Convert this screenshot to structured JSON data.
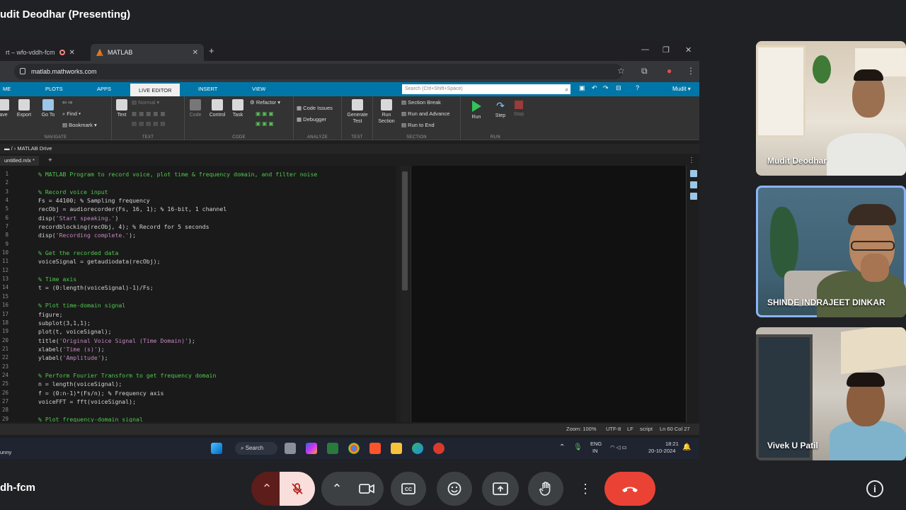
{
  "meet": {
    "presenter_title": "udit Deodhar (Presenting)",
    "meeting_code": "dh-fcm"
  },
  "browser": {
    "tabs": [
      {
        "label": "rt – wfo-vddh-fcm",
        "icon": "record-icon"
      },
      {
        "label": "MATLAB",
        "icon": "matlab-logo-icon"
      }
    ],
    "url": "matlab.mathworks.com"
  },
  "matlab": {
    "ribbon_tabs": [
      "ME",
      "PLOTS",
      "APPS",
      "LIVE EDITOR",
      "INSERT",
      "VIEW"
    ],
    "active_tab": "LIVE EDITOR",
    "search_placeholder": "Search (Ctrl+Shift+Space)",
    "user": "Mudit ▾",
    "sections": {
      "navigate": "NAVIGATE",
      "text": "TEXT",
      "code": "CODE",
      "analyze": "ANALYZE",
      "test": "TEST",
      "section": "SECTION",
      "run": "RUN"
    },
    "buttons": {
      "save": "ave",
      "export": "Export",
      "goto": "Go To",
      "find": "Find",
      "bookmark": "Bookmark",
      "text": "Text",
      "normal": "Normal",
      "code": "Code",
      "control": "Control",
      "task": "Task",
      "refactor": "Refactor",
      "code_issues": "Code Issues",
      "debugger": "Debugger",
      "generate_test_1": "Generate",
      "generate_test_2": "Test",
      "run_section_1": "Run",
      "run_section_2": "Section",
      "section_break": "Section Break",
      "run_and_advance": "Run and Advance",
      "run_to_end": "Run to End",
      "run": "Run",
      "step": "Step",
      "stop": "Stop"
    },
    "path": "MATLAB Drive",
    "file_tab": "untitled.mlx *",
    "code_lines": [
      {
        "n": "1",
        "t": "% MATLAB Program to record voice, plot time & frequency domain, and filter noise",
        "c": true
      },
      {
        "n": "2",
        "t": "",
        "c": false
      },
      {
        "n": "3",
        "t": "% Record voice input",
        "c": true
      },
      {
        "n": "4",
        "t": "Fs = 44100; % Sampling frequency",
        "c": false
      },
      {
        "n": "5",
        "t": "recObj = audiorecorder(Fs, 16, 1); % 16-bit, 1 channel",
        "c": false
      },
      {
        "n": "6",
        "t": "disp('Start speaking.')",
        "c": false
      },
      {
        "n": "7",
        "t": "recordblocking(recObj, 4); % Record for 5 seconds",
        "c": false
      },
      {
        "n": "8",
        "t": "disp('Recording complete.');",
        "c": false
      },
      {
        "n": "9",
        "t": "",
        "c": false
      },
      {
        "n": "10",
        "t": "% Get the recorded data",
        "c": true
      },
      {
        "n": "11",
        "t": "voiceSignal = getaudiodata(recObj);",
        "c": false
      },
      {
        "n": "12",
        "t": "",
        "c": false
      },
      {
        "n": "13",
        "t": "% Time axis",
        "c": true
      },
      {
        "n": "14",
        "t": "t = (0:length(voiceSignal)-1)/Fs;",
        "c": false
      },
      {
        "n": "15",
        "t": "",
        "c": false
      },
      {
        "n": "16",
        "t": "% Plot time-domain signal",
        "c": true
      },
      {
        "n": "17",
        "t": "figure;",
        "c": false
      },
      {
        "n": "18",
        "t": "subplot(3,1,1);",
        "c": false
      },
      {
        "n": "19",
        "t": "plot(t, voiceSignal);",
        "c": false
      },
      {
        "n": "20",
        "t": "title('Original Voice Signal (Time Domain)');",
        "c": false
      },
      {
        "n": "21",
        "t": "xlabel('Time (s)');",
        "c": false
      },
      {
        "n": "22",
        "t": "ylabel('Amplitude');",
        "c": false
      },
      {
        "n": "23",
        "t": "",
        "c": false
      },
      {
        "n": "24",
        "t": "% Perform Fourier Transform to get frequency domain",
        "c": true
      },
      {
        "n": "25",
        "t": "n = length(voiceSignal);",
        "c": false
      },
      {
        "n": "26",
        "t": "f = (0:n-1)*(Fs/n); % Frequency axis",
        "c": false
      },
      {
        "n": "27",
        "t": "voiceFFT = fft(voiceSignal);",
        "c": false
      },
      {
        "n": "28",
        "t": "",
        "c": false
      },
      {
        "n": "29",
        "t": "% Plot frequency-domain signal",
        "c": true
      }
    ],
    "status": {
      "zoom": "Zoom: 100%",
      "encoding": "UTF-8",
      "eol": "LF",
      "type": "script",
      "position": "Ln 60 Col 27"
    }
  },
  "taskbar": {
    "weather": "unny",
    "search": "Search",
    "lang_1": "ENG",
    "lang_2": "IN",
    "time": "18:21",
    "date": "20-10-2024"
  },
  "participants": [
    {
      "name": "Mudit Deodhar"
    },
    {
      "name": "SHINDE INDRAJEET DINKAR"
    },
    {
      "name": "Vivek U Patil"
    }
  ],
  "colors": {
    "matlab_blue": "#0076a8",
    "comment_green": "#4ec94e",
    "string_purple": "#c586c0",
    "end_call_red": "#ea4335",
    "active_speaker": "#8ab4f8"
  }
}
